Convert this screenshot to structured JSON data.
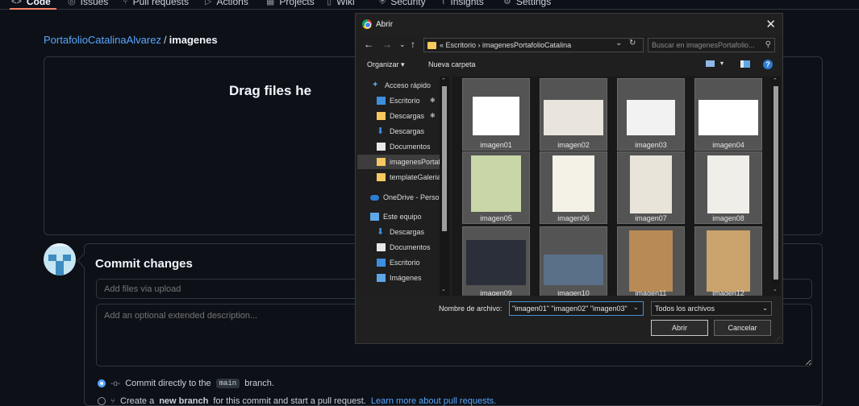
{
  "github": {
    "tabs": [
      {
        "label": "Code",
        "icon": "code-icon",
        "glyph": "<>"
      },
      {
        "label": "Issues",
        "icon": "issue-icon",
        "glyph": "◎"
      },
      {
        "label": "Pull requests",
        "icon": "pull-request-icon",
        "glyph": "⑂"
      },
      {
        "label": "Actions",
        "icon": "actions-icon",
        "glyph": "▷"
      },
      {
        "label": "Projects",
        "icon": "projects-icon",
        "glyph": "▦"
      },
      {
        "label": "Wiki",
        "icon": "wiki-icon",
        "glyph": "▯"
      },
      {
        "label": "Security",
        "icon": "security-icon",
        "glyph": "⛨"
      },
      {
        "label": "Insights",
        "icon": "insights-icon",
        "glyph": "⌇"
      },
      {
        "label": "Settings",
        "icon": "gear-icon",
        "glyph": "⚙"
      }
    ],
    "breadcrumb": {
      "repo": "PortafolioCatalinaAlvarez",
      "separator": "/",
      "dir": "imagenes"
    },
    "drag_text": "Drag files he",
    "commit": {
      "title": "Commit changes",
      "summary_placeholder": "Add files via upload",
      "description_placeholder": "Add an optional extended description...",
      "option_direct_prefix": "Commit directly to the",
      "option_direct_branch": "main",
      "option_direct_suffix": "branch.",
      "option_new_prefix": "Create a",
      "option_new_bold": "new branch",
      "option_new_suffix": "for this commit and start a pull request.",
      "option_new_link": "Learn more about pull requests."
    }
  },
  "dialog": {
    "title": "Abrir",
    "close_glyph": "✕",
    "nav": {
      "back": "←",
      "forward": "→",
      "recent": "⌄",
      "up": "↑"
    },
    "address": "« Escritorio  ›  imagenesPortafolioCatalina",
    "address_dropdown": "⌄",
    "refresh": "↻",
    "search_placeholder": "Buscar en imagenesPortafolio...",
    "toolbar": {
      "organize": "Organizar ▾",
      "new_folder": "Nueva carpeta",
      "help": "?"
    },
    "sidebar": [
      {
        "label": "Acceso rápido",
        "icon": "pin-icon"
      },
      {
        "label": "Escritorio",
        "icon": "desktop-icon",
        "pinned": true
      },
      {
        "label": "Descargas",
        "icon": "folder-icon",
        "pinned": true
      },
      {
        "label": "Descargas",
        "icon": "download-icon"
      },
      {
        "label": "Documentos",
        "icon": "document-icon"
      },
      {
        "label": "imagenesPortafolio",
        "icon": "folder-icon",
        "selected": true
      },
      {
        "label": "templateGaleria",
        "icon": "folder-icon"
      },
      {
        "label": "OneDrive - Personal",
        "icon": "cloud-icon"
      },
      {
        "label": "Este equipo",
        "icon": "computer-icon"
      },
      {
        "label": "Descargas",
        "icon": "download-icon"
      },
      {
        "label": "Documentos",
        "icon": "document-icon"
      },
      {
        "label": "Escritorio",
        "icon": "desktop-icon"
      },
      {
        "label": "Imágenes",
        "icon": "pictures-icon"
      }
    ],
    "files": [
      "imagen01",
      "imagen02",
      "imagen03",
      "imagen04",
      "imagen05",
      "imagen06",
      "imagen07",
      "imagen08",
      "imagen09",
      "imagen10",
      "imagen11",
      "imagen12"
    ],
    "filename_label": "Nombre de archivo:",
    "filename_value": "\"imagen01\" \"imagen02\" \"imagen03\"",
    "filetype": "Todos los archivos",
    "open_button": "Abrir",
    "cancel_button": "Cancelar"
  },
  "colors": {
    "accent": "#58a6ff",
    "tab_underline": "#f78166",
    "folder": "#f6c85f"
  }
}
